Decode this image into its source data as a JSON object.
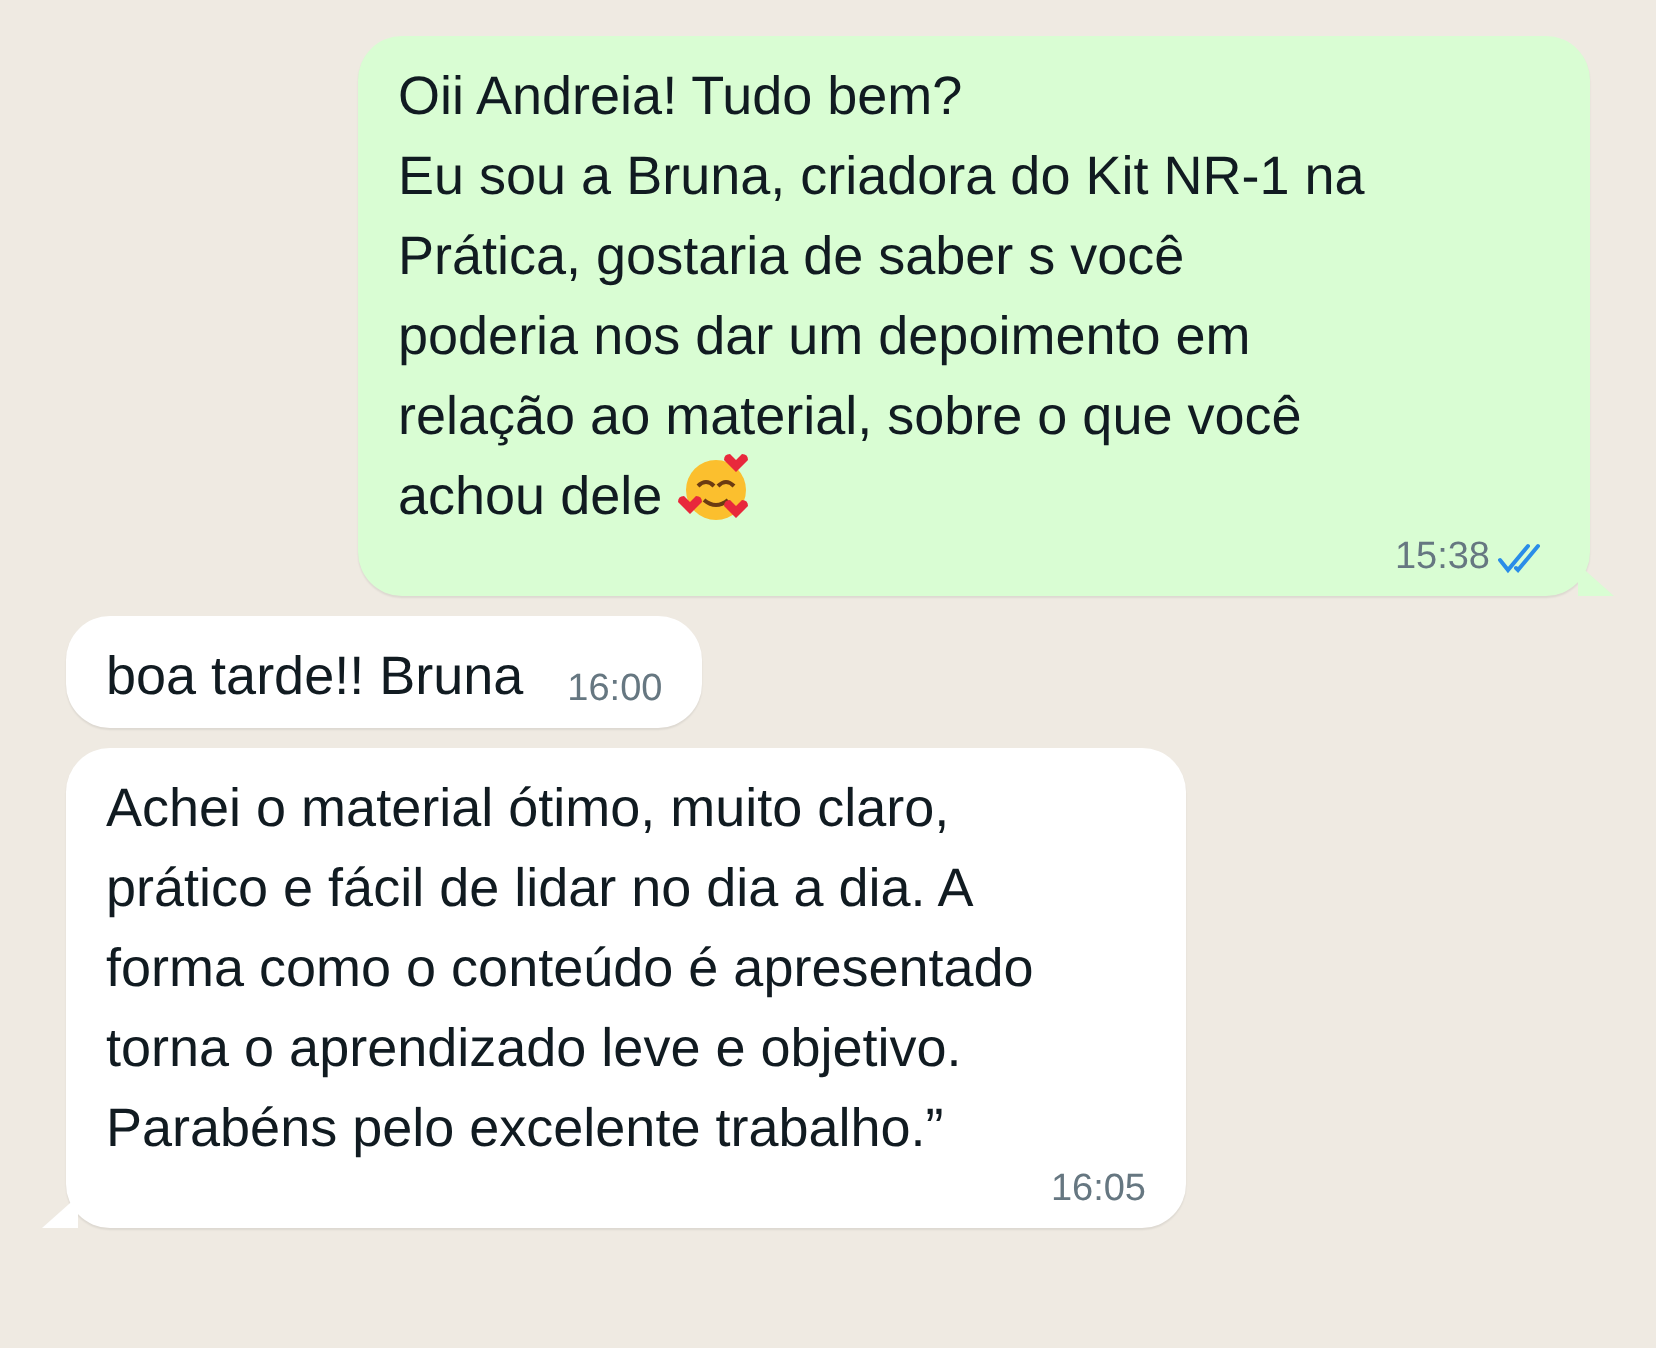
{
  "messages": [
    {
      "kind": "outgoing",
      "text": "Oii Andreia! Tudo bem?\nEu sou a Bruna, criadora do Kit NR-1 na\nPrática, gostaria de saber s você\npoderia nos dar um depoimento em\nrelação ao material, sobre o que você\nachou dele",
      "with_emoji": true,
      "time": "15:38",
      "read": true,
      "tail": true
    },
    {
      "kind": "incoming",
      "text": "boa tarde!! Bruna",
      "time": "16:00",
      "tail": false
    },
    {
      "kind": "incoming",
      "text": "Achei o material ótimo, muito claro,\nprático e fácil de lidar no dia a dia. A\nforma como o conteúdo é apresentado\ntorna o aprendizado leve e objetivo.\nParabéns pelo excelente trabalho.”",
      "time": "16:05",
      "tail": true
    }
  ]
}
